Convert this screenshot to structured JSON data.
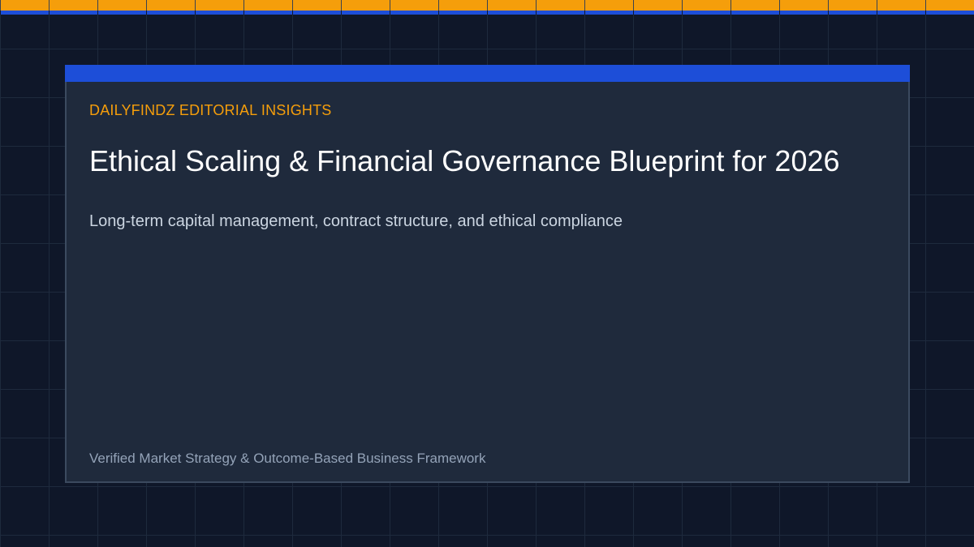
{
  "brand": {
    "eyebrow": "DAILYFINDZ EDITORIAL INSIGHTS"
  },
  "content": {
    "title": "Ethical Scaling & Financial Governance Blueprint for 2026",
    "subtitle": "Long-term capital management, contract structure, and ethical compliance",
    "footer": "Verified Market Strategy & Outcome-Based Business Framework"
  },
  "colors": {
    "background": "#0f1729",
    "accent_orange": "#f59e0b",
    "accent_blue": "#1d4ed8",
    "card": "#1f2a3c"
  }
}
